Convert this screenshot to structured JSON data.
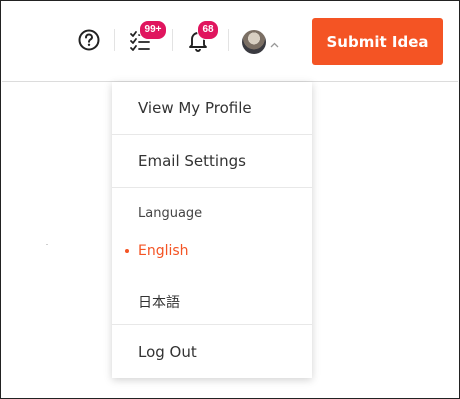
{
  "header": {
    "help_icon": "question-circle-icon",
    "tasks_icon": "checklist-icon",
    "tasks_badge": "99+",
    "notifications_icon": "bell-icon",
    "notifications_badge": "68",
    "avatar_icon": "user-avatar",
    "caret_icon": "chevron-up-icon",
    "submit_label": "Submit Idea"
  },
  "menu": {
    "profile_label": "View My Profile",
    "email_label": "Email Settings",
    "language_heading": "Language",
    "languages": [
      {
        "label": "English",
        "selected": true
      },
      {
        "label": "日本語",
        "selected": false
      }
    ],
    "logout_label": "Log Out"
  },
  "colors": {
    "accent": "#f45424",
    "badge": "#e0155e"
  }
}
